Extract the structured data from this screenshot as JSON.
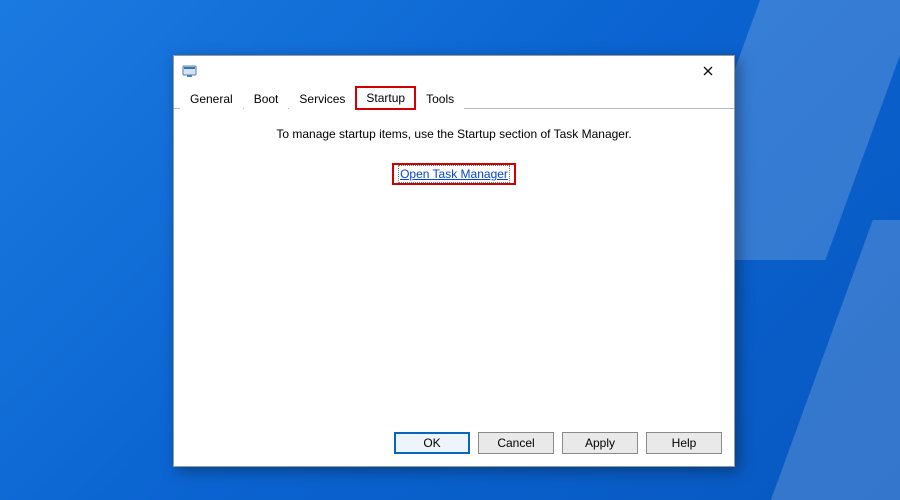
{
  "tabs": {
    "general": "General",
    "boot": "Boot",
    "services": "Services",
    "startup": "Startup",
    "tools": "Tools",
    "active": "startup"
  },
  "content": {
    "info": "To manage startup items, use the Startup section of Task Manager.",
    "link": "Open Task Manager"
  },
  "buttons": {
    "ok": "OK",
    "cancel": "Cancel",
    "apply": "Apply",
    "help": "Help"
  }
}
